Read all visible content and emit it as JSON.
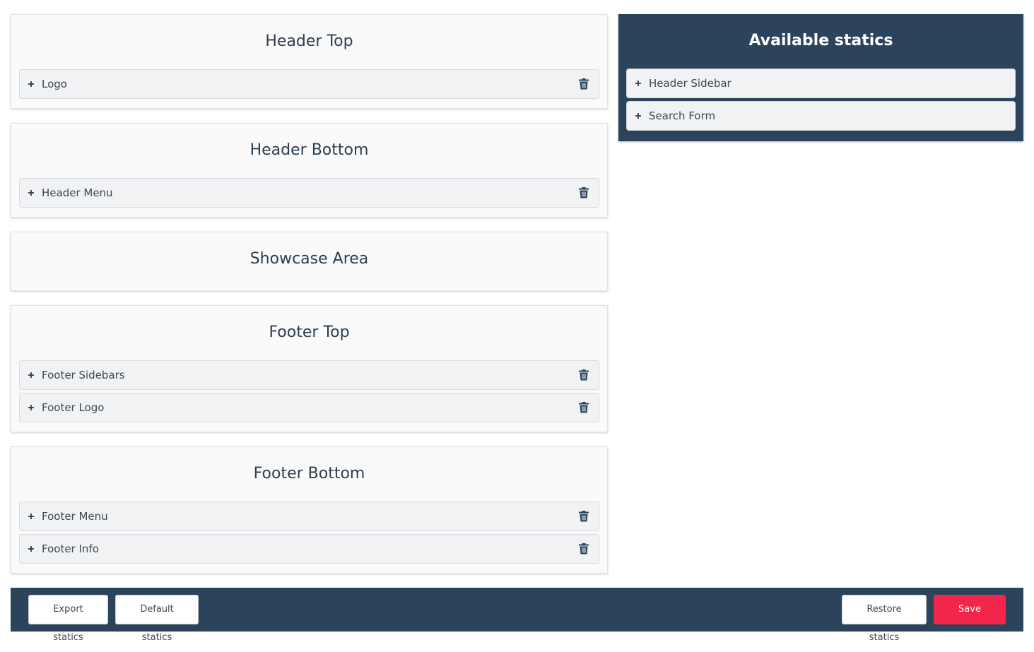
{
  "areas": [
    {
      "title": "Header Top",
      "items": [
        {
          "label": "Logo"
        }
      ]
    },
    {
      "title": "Header Bottom",
      "items": [
        {
          "label": "Header Menu"
        }
      ]
    },
    {
      "title": "Showcase Area",
      "items": []
    },
    {
      "title": "Footer Top",
      "items": [
        {
          "label": "Footer Sidebars"
        },
        {
          "label": "Footer Logo"
        }
      ]
    },
    {
      "title": "Footer Bottom",
      "items": [
        {
          "label": "Footer Menu"
        },
        {
          "label": "Footer Info"
        }
      ]
    }
  ],
  "available": {
    "title": "Available statics",
    "items": [
      {
        "label": "Header Sidebar"
      },
      {
        "label": "Search Form"
      }
    ]
  },
  "footer": {
    "export_label": "Export statics",
    "default_label": "Default statics",
    "restore_label": "Restore statics",
    "save_label": "Save statics"
  },
  "icons": {
    "expand": "plus-icon",
    "delete": "trash-icon"
  },
  "colors": {
    "navy": "#2c435c",
    "save": "#f4254a",
    "title": "#2c3e50"
  }
}
